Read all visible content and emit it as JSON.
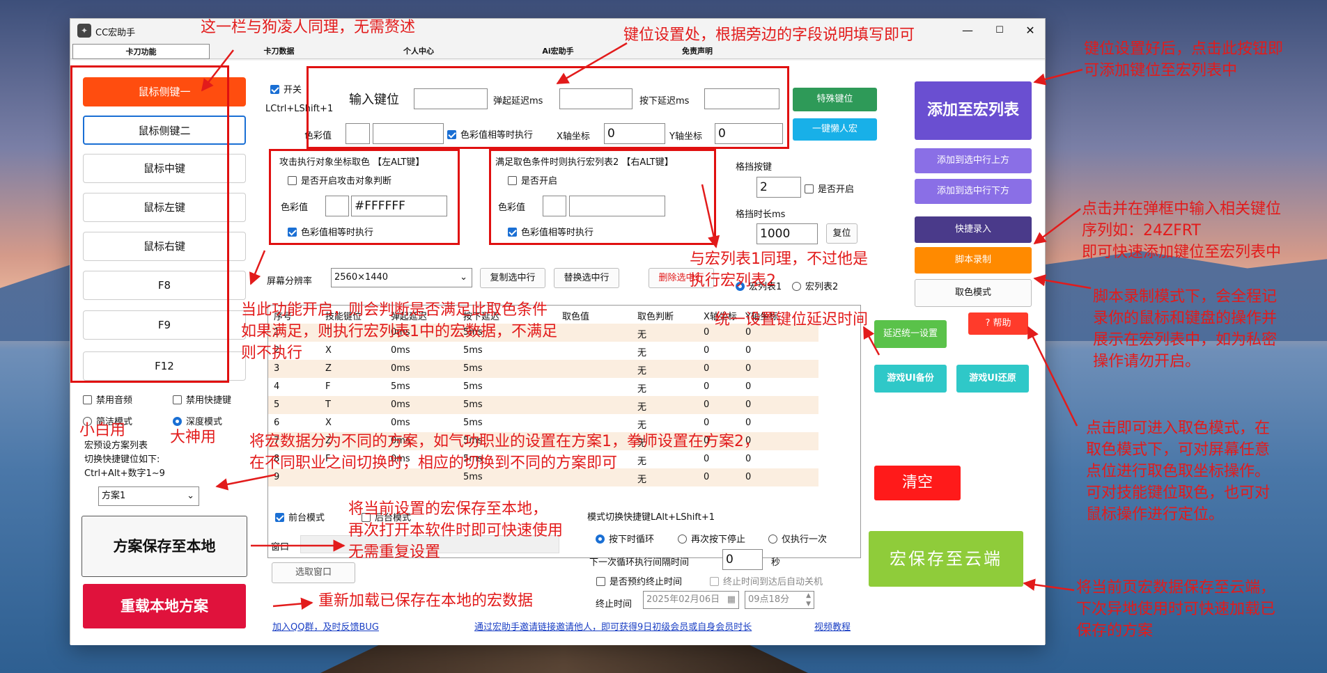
{
  "window": {
    "title": "CC宏助手",
    "min": "—",
    "max": "☐",
    "close": "✕"
  },
  "tabs": [
    "卡刀功能",
    "卡刀数据",
    "个人中心",
    "Ai宏助手",
    "免责声明"
  ],
  "side_buttons": [
    "鼠标侧键一",
    "鼠标侧键二",
    "鼠标中键",
    "鼠标左键",
    "鼠标右键",
    "F8",
    "F9",
    "F12"
  ],
  "options": {
    "mute": "禁用音频",
    "disable_hotkey": "禁用快捷键",
    "simple_mode": "简洁模式",
    "deep_mode": "深度模式",
    "preset_text1": "宏预设方案列表",
    "preset_text2": "切换快捷键位如下:",
    "preset_text3": "Ctrl+Alt+数字1~9",
    "scheme_value": "方案1"
  },
  "left_actions": {
    "save_local": "方案保存至本地",
    "reload_local": "重载本地方案"
  },
  "keyset": {
    "switch_label": "开关",
    "switch_hotkey": "LCtrl+LShift+1",
    "input_key": "输入键位",
    "bounce_delay": "弹起延迟ms",
    "press_delay": "按下延迟ms",
    "color_value": "色彩值",
    "color_equal": "色彩值相等时执行",
    "x_label": "X轴坐标",
    "x_value": "0",
    "y_label": "Y轴坐标",
    "y_value": "0",
    "special_key": "特殊键位",
    "lazy_macro": "一键懒人宏"
  },
  "attack": {
    "title": "攻击执行对象坐标取色 【左ALT键】",
    "enable": "是否开启攻击对象判断",
    "color_label": "色彩值",
    "color_value": "#FFFFFF",
    "equal_exec": "色彩值相等时执行"
  },
  "satisfy": {
    "title": "满足取色条件时则执行宏列表2 【右ALT键】",
    "enable": "是否开启",
    "color_label": "色彩值",
    "equal_exec": "色彩值相等时执行"
  },
  "grid_key": {
    "label": "格挡按键",
    "value": "2",
    "enable": "是否开启",
    "duration_label": "格挡时长ms",
    "duration_value": "1000",
    "reset": "复位"
  },
  "right_buttons": {
    "add_macro": "添加至宏列表",
    "add_above": "添加到选中行上方",
    "add_below": "添加到选中行下方",
    "quick_record": "快捷录入",
    "script_record": "脚本录制",
    "color_mode": "取色模式",
    "help": "? 帮助",
    "delay_unify": "延迟统一设置",
    "ui_backup": "游戏UI备份",
    "ui_restore": "游戏UI还原",
    "clear": "清空",
    "cloud_save": "宏保存至云端"
  },
  "screen": {
    "label": "屏幕分辨率",
    "value": "2560×1440",
    "copy_row": "复制选中行",
    "replace_row": "替换选中行",
    "delete_row": "删除选中行",
    "list1": "宏列表1",
    "list2": "宏列表2"
  },
  "table": {
    "headers": [
      "序号",
      "技能键位",
      "弹起延迟",
      "按下延迟",
      "取色值",
      "取色判断",
      "X轴坐标",
      "Y轴坐标"
    ],
    "rows": [
      [
        "1",
        "T",
        "0ms",
        "5ms",
        "",
        "无",
        "0",
        "0"
      ],
      [
        "2",
        "X",
        "0ms",
        "5ms",
        "",
        "无",
        "0",
        "0"
      ],
      [
        "3",
        "Z",
        "0ms",
        "5ms",
        "",
        "无",
        "0",
        "0"
      ],
      [
        "4",
        "F",
        "5ms",
        "5ms",
        "",
        "无",
        "0",
        "0"
      ],
      [
        "5",
        "T",
        "0ms",
        "5ms",
        "",
        "无",
        "0",
        "0"
      ],
      [
        "6",
        "X",
        "0ms",
        "5ms",
        "",
        "无",
        "0",
        "0"
      ],
      [
        "7",
        "Z",
        "0ms",
        "5ms",
        "",
        "无",
        "0",
        "0"
      ],
      [
        "8",
        "F",
        "0ms",
        "5ms",
        "",
        "无",
        "0",
        "0"
      ],
      [
        "9",
        "",
        "",
        "5ms",
        "",
        "无",
        "0",
        "0"
      ]
    ]
  },
  "bottom": {
    "front_mode": "前台模式",
    "back_mode": "后台模式",
    "window_label": "窗口",
    "select_window": "选取窗口",
    "mode_hotkey": "模式切换快捷键LAlt+LShift+1",
    "loop_on_press": "按下时循环",
    "stop_on_repress": "再次按下停止",
    "run_once": "仅执行一次",
    "interval_label": "下一次循环执行间隔时间",
    "interval_value": "0",
    "seconds": "秒",
    "schedule_end": "是否预约终止时间",
    "auto_shutdown": "终止时间到达后自动关机",
    "end_time_label": "终止时间",
    "end_date": "2025年02月06日",
    "end_clock": "09点18分"
  },
  "links": {
    "qq": "加入QQ群，及时反馈BUG",
    "invite": "通过宏助手邀请链接邀请他人，即可获得9日初级会员或自身会员时长",
    "video": "视频教程"
  },
  "annotations": {
    "a1": "这一栏与狗凌人同理，无需赘述",
    "a2": "键位设置处，根据旁边的字段说明填写即可",
    "a3": [
      "键位设置好后，点击此按钮即",
      "可添加键位至宏列表中"
    ],
    "a4": [
      "点击并在弹框中输入相关键位",
      "序列如：24ZFRT",
      "即可快速添加键位至宏列表中"
    ],
    "a5": [
      "脚本录制模式下，会全程记",
      "录你的鼠标和键盘的操作并",
      "展示在宏列表中，如为私密",
      "操作请勿开启。"
    ],
    "a6": [
      "点击即可进入取色模式，在",
      "取色模式下，可对屏幕任意",
      "点位进行取色取坐标操作。",
      "可对技能键位取色，也可对",
      "鼠标操作进行定位。"
    ],
    "a7": [
      "将当前页宏数据保存至云端，",
      "下次异地使用时可快速加载已",
      "保存的方案"
    ],
    "a8": [
      "当此功能开启，则会判断是否满足此取色条件",
      "如果满足，则执行宏列表1中的宏数据，不满足",
      "则不执行"
    ],
    "a9": [
      "与宏列表1同理，不过他是",
      "执行宏列表2"
    ],
    "a10": "统一设置键位延迟时间",
    "a11": [
      "将宏数据分为不同的方案，如气功职业的设置在方案1，拳师设置在方案2，",
      "在不同职业之间切换时，相应的切换到不同的方案即可"
    ],
    "a12": "小白用",
    "a13": "大神用",
    "a14": [
      "将当前设置的宏保存至本地，",
      "再次打开本软件时即可快速使用",
      "无需重复设置"
    ],
    "a15": "重新加载已保存在本地的宏数据"
  },
  "colors": {
    "annotation": "#e21b1b",
    "side_active": "#ff4d0f",
    "add_macro": "#6a4fd1",
    "add_rows": "#8a6fe6",
    "quick_record": "#4a3a8a",
    "script_record": "#ff8a00",
    "special_key": "#2e9a58",
    "lazy_macro": "#18b0e8",
    "delay_unify": "#5ac24a",
    "ui_buttons": "#2fc8c8",
    "clear": "#ff1a1a",
    "cloud_save": "#8fcc3a",
    "reload_local": "#e0123c",
    "help": "#ff3b2b"
  }
}
